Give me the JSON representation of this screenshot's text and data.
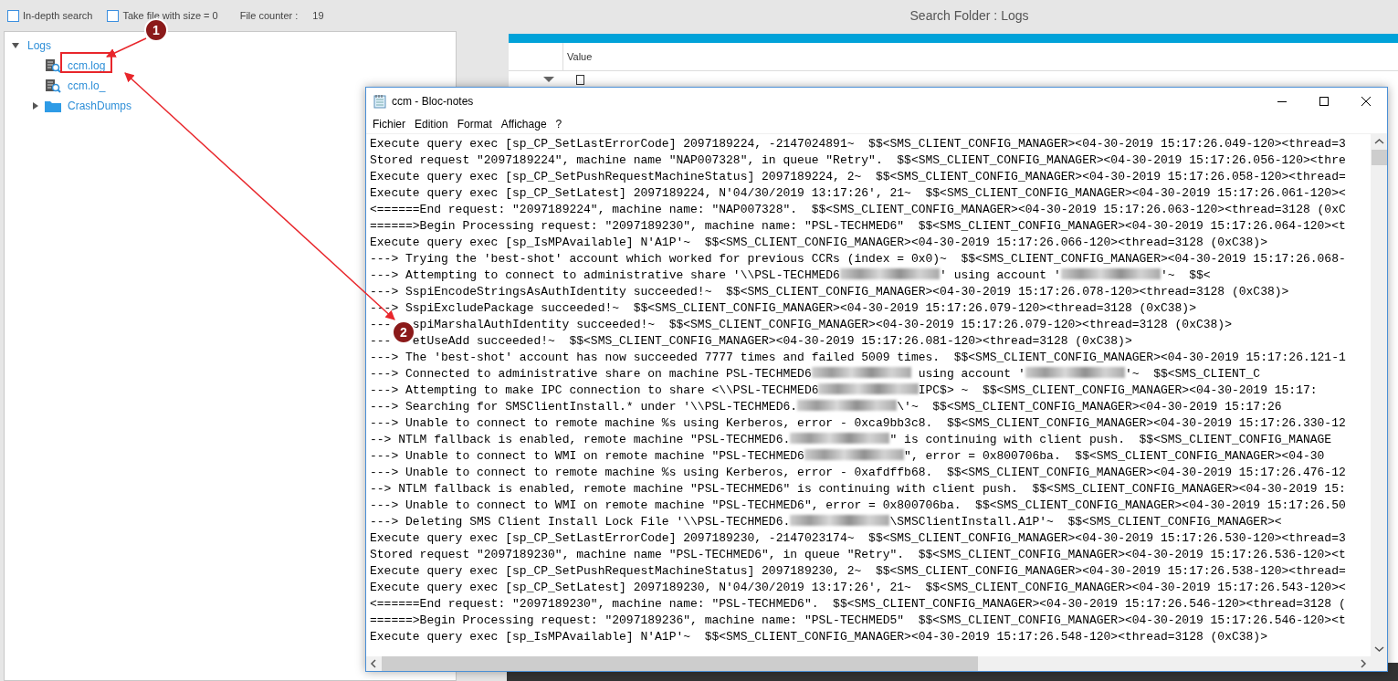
{
  "toolbar": {
    "options": [
      {
        "label": "In-depth search",
        "checked": false
      },
      {
        "label": "Take file with size = 0",
        "checked": false
      }
    ],
    "counter_label": "File counter :",
    "counter_value": "19"
  },
  "title": "Search Folder : Logs",
  "tree": [
    {
      "label": "Logs",
      "kind": "folder-root",
      "expanded": true,
      "children": [
        {
          "label": "ccm.log",
          "kind": "file"
        },
        {
          "label": "ccm.lo_",
          "kind": "file"
        },
        {
          "label": "CrashDumps",
          "kind": "folder",
          "expanded": false
        }
      ]
    }
  ],
  "grid": {
    "columns": [
      "Value"
    ]
  },
  "notepad": {
    "title": "ccm - Bloc-notes",
    "menu": [
      "Fichier",
      "Edition",
      "Format",
      "Affichage",
      "?"
    ],
    "lines": [
      {
        "text": "Execute query exec [sp_CP_SetLastErrorCode] 2097189224, -2147024891~  $$<SMS_CLIENT_CONFIG_MANAGER><04-30-2019 15:17:26.049-120><thread=3"
      },
      {
        "text": "Stored request \"2097189224\", machine name \"NAP007328\", in queue \"Retry\".  $$<SMS_CLIENT_CONFIG_MANAGER><04-30-2019 15:17:26.056-120><thre"
      },
      {
        "text": "Execute query exec [sp_CP_SetPushRequestMachineStatus] 2097189224, 2~  $$<SMS_CLIENT_CONFIG_MANAGER><04-30-2019 15:17:26.058-120><thread="
      },
      {
        "text": "Execute query exec [sp_CP_SetLatest] 2097189224, N'04/30/2019 13:17:26', 21~  $$<SMS_CLIENT_CONFIG_MANAGER><04-30-2019 15:17:26.061-120><"
      },
      {
        "text": "<======End request: \"2097189224\", machine name: \"NAP007328\".  $$<SMS_CLIENT_CONFIG_MANAGER><04-30-2019 15:17:26.063-120><thread=3128 (0xC"
      },
      {
        "text": "======>Begin Processing request: \"2097189230\", machine name: \"PSL-TECHMED6\"  $$<SMS_CLIENT_CONFIG_MANAGER><04-30-2019 15:17:26.064-120><t"
      },
      {
        "text": "Execute query exec [sp_IsMPAvailable] N'A1P'~  $$<SMS_CLIENT_CONFIG_MANAGER><04-30-2019 15:17:26.066-120><thread=3128 (0xC38)>"
      },
      {
        "text": "---> Trying the 'best-shot' account which worked for previous CCRs (index = 0x0)~  $$<SMS_CLIENT_CONFIG_MANAGER><04-30-2019 15:17:26.068-"
      },
      {
        "parts": [
          {
            "kind": "text",
            "text": "---> Attempting to connect to administrative share '\\\\PSL-TECHMED6"
          },
          {
            "kind": "redacted"
          },
          {
            "kind": "text",
            "text": "' using account '"
          },
          {
            "kind": "redacted"
          },
          {
            "kind": "text",
            "text": "'~  $$<"
          }
        ]
      },
      {
        "text": "---> SspiEncodeStringsAsAuthIdentity succeeded!~  $$<SMS_CLIENT_CONFIG_MANAGER><04-30-2019 15:17:26.078-120><thread=3128 (0xC38)>"
      },
      {
        "text": "---> SspiExcludePackage succeeded!~  $$<SMS_CLIENT_CONFIG_MANAGER><04-30-2019 15:17:26.079-120><thread=3128 (0xC38)>"
      },
      {
        "parts": [
          {
            "kind": "text",
            "text": "---"
          },
          {
            "kind": "covered"
          },
          {
            "kind": "text",
            "text": "spiMarshalAuthIdentity succeeded!~  $$<SMS_CLIENT_CONFIG_MANAGER><04-30-2019 15:17:26.079-120><thread=3128 (0xC38)>"
          }
        ]
      },
      {
        "parts": [
          {
            "kind": "text",
            "text": "---"
          },
          {
            "kind": "covered"
          },
          {
            "kind": "text",
            "text": "etUseAdd succeeded!~  $$<SMS_CLIENT_CONFIG_MANAGER><04-30-2019 15:17:26.081-120><thread=3128 (0xC38)>"
          }
        ]
      },
      {
        "text": "---> The 'best-shot' account has now succeeded 7777 times and failed 5009 times.  $$<SMS_CLIENT_CONFIG_MANAGER><04-30-2019 15:17:26.121-1"
      },
      {
        "parts": [
          {
            "kind": "text",
            "text": "---> Connected to administrative share on machine PSL-TECHMED6"
          },
          {
            "kind": "redacted"
          },
          {
            "kind": "text",
            "text": " using account '"
          },
          {
            "kind": "redacted"
          },
          {
            "kind": "text",
            "text": "'~  $$<SMS_CLIENT_C"
          }
        ]
      },
      {
        "parts": [
          {
            "kind": "text",
            "text": "---> Attempting to make IPC connection to share <\\\\PSL-TECHMED6"
          },
          {
            "kind": "redacted"
          },
          {
            "kind": "text",
            "text": "IPC$> ~  $$<SMS_CLIENT_CONFIG_MANAGER><04-30-2019 15:17:"
          }
        ]
      },
      {
        "parts": [
          {
            "kind": "text",
            "text": "---> Searching for SMSClientInstall.* under '\\\\PSL-TECHMED6."
          },
          {
            "kind": "redacted"
          },
          {
            "kind": "text",
            "text": "\\'~  $$<SMS_CLIENT_CONFIG_MANAGER><04-30-2019 15:17:26"
          }
        ]
      },
      {
        "text": "---> Unable to connect to remote machine %s using Kerberos, error - 0xca9bb3c8.  $$<SMS_CLIENT_CONFIG_MANAGER><04-30-2019 15:17:26.330-12"
      },
      {
        "parts": [
          {
            "kind": "text",
            "text": "--> NTLM fallback is enabled, remote machine \"PSL-TECHMED6."
          },
          {
            "kind": "redacted"
          },
          {
            "kind": "text",
            "text": "\" is continuing with client push.  $$<SMS_CLIENT_CONFIG_MANAGE"
          }
        ]
      },
      {
        "parts": [
          {
            "kind": "text",
            "text": "---> Unable to connect to WMI on remote machine \"PSL-TECHMED6"
          },
          {
            "kind": "redacted"
          },
          {
            "kind": "text",
            "text": "\", error = 0x800706ba.  $$<SMS_CLIENT_CONFIG_MANAGER><04-30"
          }
        ]
      },
      {
        "text": "---> Unable to connect to remote machine %s using Kerberos, error - 0xafdffb68.  $$<SMS_CLIENT_CONFIG_MANAGER><04-30-2019 15:17:26.476-12"
      },
      {
        "text": "--> NTLM fallback is enabled, remote machine \"PSL-TECHMED6\" is continuing with client push.  $$<SMS_CLIENT_CONFIG_MANAGER><04-30-2019 15:"
      },
      {
        "text": "---> Unable to connect to WMI on remote machine \"PSL-TECHMED6\", error = 0x800706ba.  $$<SMS_CLIENT_CONFIG_MANAGER><04-30-2019 15:17:26.50"
      },
      {
        "parts": [
          {
            "kind": "text",
            "text": "---> Deleting SMS Client Install Lock File '\\\\PSL-TECHMED6."
          },
          {
            "kind": "redacted"
          },
          {
            "kind": "text",
            "text": "\\SMSClientInstall.A1P'~  $$<SMS_CLIENT_CONFIG_MANAGER><"
          }
        ]
      },
      {
        "text": "Execute query exec [sp_CP_SetLastErrorCode] 2097189230, -2147023174~  $$<SMS_CLIENT_CONFIG_MANAGER><04-30-2019 15:17:26.530-120><thread=3"
      },
      {
        "text": "Stored request \"2097189230\", machine name \"PSL-TECHMED6\", in queue \"Retry\".  $$<SMS_CLIENT_CONFIG_MANAGER><04-30-2019 15:17:26.536-120><t"
      },
      {
        "text": "Execute query exec [sp_CP_SetPushRequestMachineStatus] 2097189230, 2~  $$<SMS_CLIENT_CONFIG_MANAGER><04-30-2019 15:17:26.538-120><thread="
      },
      {
        "text": "Execute query exec [sp_CP_SetLatest] 2097189230, N'04/30/2019 13:17:26', 21~  $$<SMS_CLIENT_CONFIG_MANAGER><04-30-2019 15:17:26.543-120><"
      },
      {
        "text": "<======End request: \"2097189230\", machine name: \"PSL-TECHMED6\".  $$<SMS_CLIENT_CONFIG_MANAGER><04-30-2019 15:17:26.546-120><thread=3128 ("
      },
      {
        "text": "======>Begin Processing request: \"2097189236\", machine name: \"PSL-TECHMED5\"  $$<SMS_CLIENT_CONFIG_MANAGER><04-30-2019 15:17:26.546-120><t"
      },
      {
        "text": "Execute query exec [sp_IsMPAvailable] N'A1P'~  $$<SMS_CLIENT_CONFIG_MANAGER><04-30-2019 15:17:26.548-120><thread=3128 (0xC38)>"
      }
    ]
  },
  "annotations": [
    {
      "number": "1"
    },
    {
      "number": "2"
    }
  ]
}
